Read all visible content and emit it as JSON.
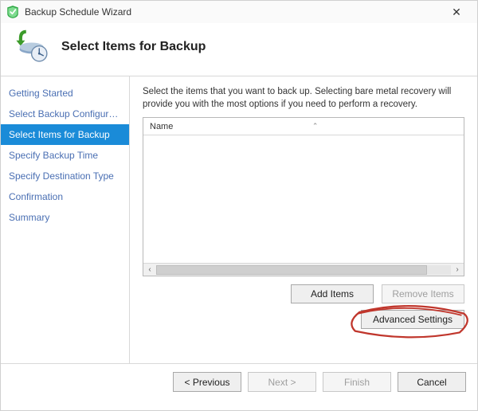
{
  "window": {
    "title": "Backup Schedule Wizard",
    "close_glyph": "✕"
  },
  "header": {
    "title": "Select Items for Backup"
  },
  "sidebar": {
    "items": [
      {
        "label": "Getting Started"
      },
      {
        "label": "Select Backup Configurat..."
      },
      {
        "label": "Select Items for Backup",
        "selected": true
      },
      {
        "label": "Specify Backup Time"
      },
      {
        "label": "Specify Destination Type"
      },
      {
        "label": "Confirmation"
      },
      {
        "label": "Summary"
      }
    ]
  },
  "main": {
    "instructions": "Select the items that you want to back up. Selecting bare metal recovery will provide you with the most options if you need to perform a recovery.",
    "list_header": "Name",
    "add_items_label": "Add Items",
    "remove_items_label": "Remove Items",
    "advanced_settings_label": "Advanced Settings"
  },
  "footer": {
    "previous": "< Previous",
    "next": "Next >",
    "finish": "Finish",
    "cancel": "Cancel"
  }
}
